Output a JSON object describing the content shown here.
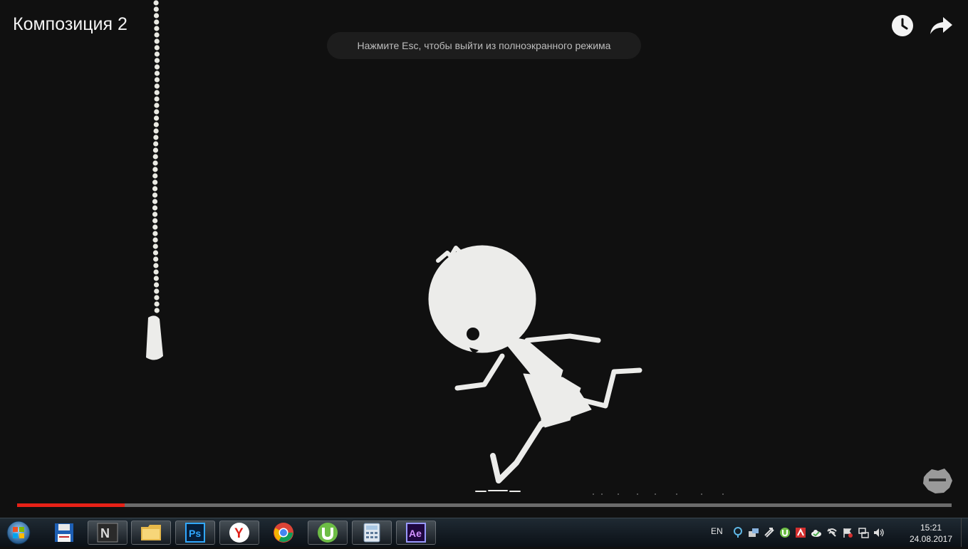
{
  "player": {
    "title": "Композиция 2",
    "esc_hint": "Нажмите Esc, чтобы выйти из полноэкранного режима",
    "progress_fraction": 0.115,
    "progress_color": "#e62117",
    "watch_later_icon": "clock-icon",
    "share_icon": "share-arrow-icon"
  },
  "taskbar": {
    "start_icon": "windows-start-icon",
    "apps": [
      {
        "name": "save-floppy",
        "label": "",
        "active": false
      },
      {
        "name": "nero",
        "label": "",
        "active": true
      },
      {
        "name": "file-explorer",
        "label": "",
        "active": true
      },
      {
        "name": "photoshop",
        "label": "Ps",
        "active": true
      },
      {
        "name": "yandex-browser",
        "label": "Y",
        "active": true
      },
      {
        "name": "chrome",
        "label": "",
        "active": false
      },
      {
        "name": "utorrent",
        "label": "",
        "active": true
      },
      {
        "name": "calculator",
        "label": "",
        "active": true
      },
      {
        "name": "after-effects",
        "label": "Ae",
        "active": true
      }
    ],
    "language": "EN",
    "tray_icons": [
      "help-icon",
      "network-share-icon",
      "sync-icon",
      "utorrent-tray-icon",
      "antivirus-icon",
      "cloud-icon",
      "wifi-off-icon",
      "flag-icon",
      "network-icon",
      "volume-icon"
    ],
    "clock_time": "15:21",
    "clock_date": "24.08.2017"
  }
}
